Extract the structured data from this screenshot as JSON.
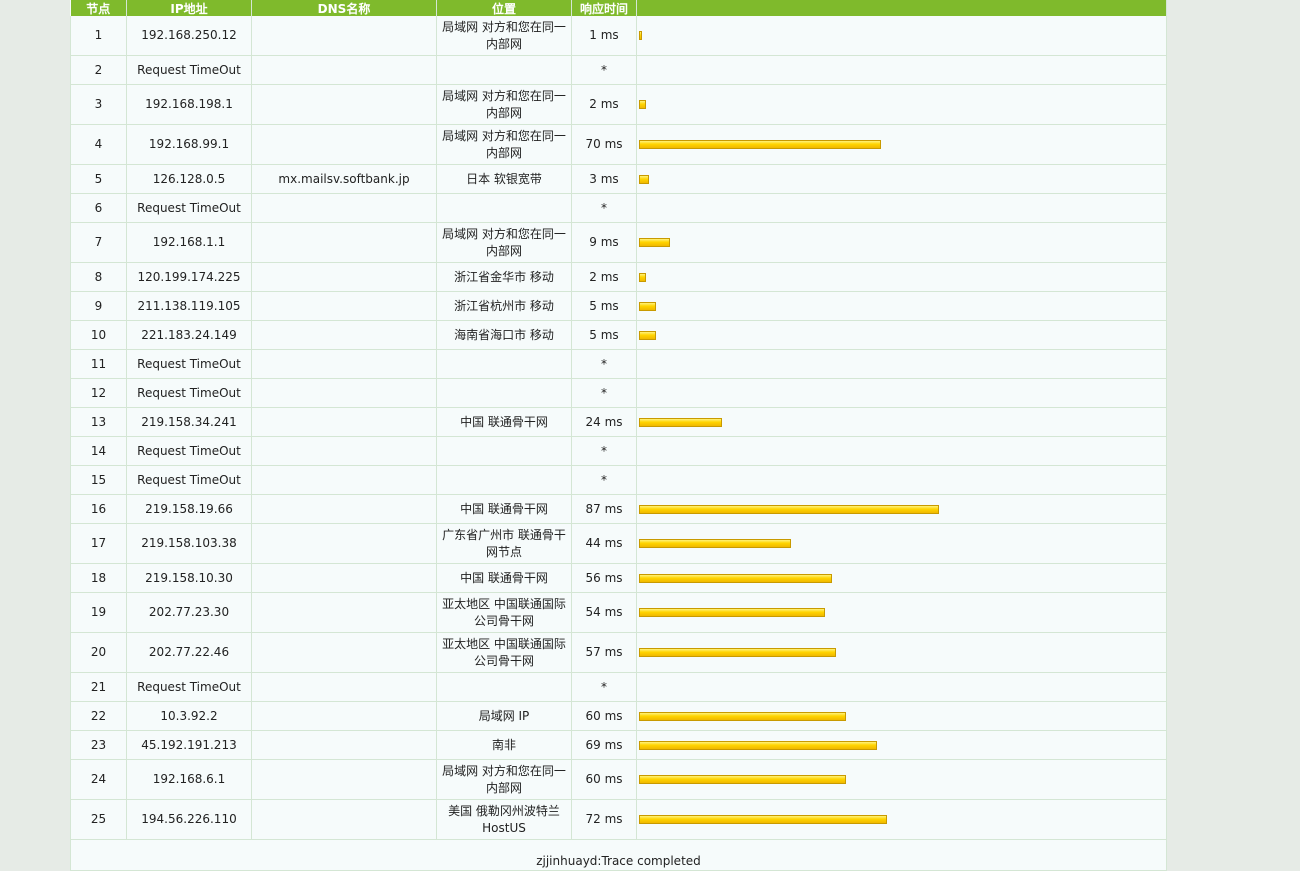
{
  "header": {
    "cols": [
      "节点",
      "IP地址",
      "DNS名称",
      "位置",
      "响应时间",
      ""
    ]
  },
  "hops": [
    {
      "hop": "1",
      "ip": "192.168.250.12",
      "dns": "",
      "loc": "局域网 对方和您在同一内部网",
      "time": "1 ms",
      "ms": 1
    },
    {
      "hop": "2",
      "ip": "Request TimeOut",
      "dns": "",
      "loc": "",
      "time": "*",
      "ms": 0
    },
    {
      "hop": "3",
      "ip": "192.168.198.1",
      "dns": "",
      "loc": "局域网 对方和您在同一内部网",
      "time": "2 ms",
      "ms": 2
    },
    {
      "hop": "4",
      "ip": "192.168.99.1",
      "dns": "",
      "loc": "局域网 对方和您在同一内部网",
      "time": "70 ms",
      "ms": 70
    },
    {
      "hop": "5",
      "ip": "126.128.0.5",
      "dns": "mx.mailsv.softbank.jp",
      "loc": "日本 软银宽带",
      "time": "3 ms",
      "ms": 3
    },
    {
      "hop": "6",
      "ip": "Request TimeOut",
      "dns": "",
      "loc": "",
      "time": "*",
      "ms": 0
    },
    {
      "hop": "7",
      "ip": "192.168.1.1",
      "dns": "",
      "loc": "局域网 对方和您在同一内部网",
      "time": "9 ms",
      "ms": 9
    },
    {
      "hop": "8",
      "ip": "120.199.174.225",
      "dns": "",
      "loc": "浙江省金华市 移动",
      "time": "2 ms",
      "ms": 2
    },
    {
      "hop": "9",
      "ip": "211.138.119.105",
      "dns": "",
      "loc": "浙江省杭州市 移动",
      "time": "5 ms",
      "ms": 5
    },
    {
      "hop": "10",
      "ip": "221.183.24.149",
      "dns": "",
      "loc": "海南省海口市 移动",
      "time": "5 ms",
      "ms": 5
    },
    {
      "hop": "11",
      "ip": "Request TimeOut",
      "dns": "",
      "loc": "",
      "time": "*",
      "ms": 0
    },
    {
      "hop": "12",
      "ip": "Request TimeOut",
      "dns": "",
      "loc": "",
      "time": "*",
      "ms": 0
    },
    {
      "hop": "13",
      "ip": "219.158.34.241",
      "dns": "",
      "loc": "中国 联通骨干网",
      "time": "24 ms",
      "ms": 24
    },
    {
      "hop": "14",
      "ip": "Request TimeOut",
      "dns": "",
      "loc": "",
      "time": "*",
      "ms": 0
    },
    {
      "hop": "15",
      "ip": "Request TimeOut",
      "dns": "",
      "loc": "",
      "time": "*",
      "ms": 0
    },
    {
      "hop": "16",
      "ip": "219.158.19.66",
      "dns": "",
      "loc": "中国 联通骨干网",
      "time": "87 ms",
      "ms": 87
    },
    {
      "hop": "17",
      "ip": "219.158.103.38",
      "dns": "",
      "loc": "广东省广州市 联通骨干网节点",
      "time": "44 ms",
      "ms": 44
    },
    {
      "hop": "18",
      "ip": "219.158.10.30",
      "dns": "",
      "loc": "中国 联通骨干网",
      "time": "56 ms",
      "ms": 56
    },
    {
      "hop": "19",
      "ip": "202.77.23.30",
      "dns": "",
      "loc": "亚太地区 中国联通国际公司骨干网",
      "time": "54 ms",
      "ms": 54
    },
    {
      "hop": "20",
      "ip": "202.77.22.46",
      "dns": "",
      "loc": "亚太地区 中国联通国际公司骨干网",
      "time": "57 ms",
      "ms": 57
    },
    {
      "hop": "21",
      "ip": "Request TimeOut",
      "dns": "",
      "loc": "",
      "time": "*",
      "ms": 0
    },
    {
      "hop": "22",
      "ip": "10.3.92.2",
      "dns": "",
      "loc": "局域网 IP",
      "time": "60 ms",
      "ms": 60
    },
    {
      "hop": "23",
      "ip": "45.192.191.213",
      "dns": "",
      "loc": "南非",
      "time": "69 ms",
      "ms": 69
    },
    {
      "hop": "24",
      "ip": "192.168.6.1",
      "dns": "",
      "loc": "局域网 对方和您在同一内部网",
      "time": "60 ms",
      "ms": 60
    },
    {
      "hop": "25",
      "ip": "194.56.226.110",
      "dns": "",
      "loc": "美国 俄勒冈州波特兰HostUS",
      "time": "72 ms",
      "ms": 72
    }
  ],
  "footer": {
    "status": "zjjinhuayd:Trace completed"
  },
  "colors": {
    "header_bg": "#7fba2c",
    "bar": "#ffd400",
    "row_bg": "#f6fbfb"
  }
}
